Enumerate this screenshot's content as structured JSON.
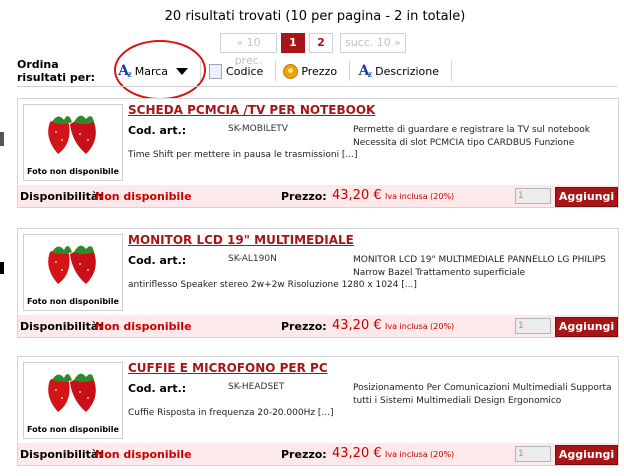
{
  "summary": "20 risultati trovati (10 per pagina - 2 in totale)",
  "pager": {
    "prev": "« 10 prec.",
    "pages": [
      "1",
      "2"
    ],
    "current": "1",
    "next": "succ. 10 »"
  },
  "sort": {
    "label": "Ordina risultati per:",
    "options": [
      {
        "label": "Marca",
        "icon": "az-sort-icon"
      },
      {
        "label": "Codice",
        "icon": "code-list-icon"
      },
      {
        "label": "Prezzo",
        "icon": "coin-icon"
      },
      {
        "label": "Descrizione",
        "icon": "az-sort-icon"
      }
    ]
  },
  "colors": {
    "accent": "#a81516",
    "price": "#c80000",
    "footer_bg": "#fde8ea",
    "annotation_circle": "#d41616"
  },
  "products": [
    {
      "image_caption": "Foto non disponibile",
      "title": "SCHEDA PCMCIA /TV PER NOTEBOOK",
      "code_label": "Cod. art.:",
      "code": "SK-MOBILETV",
      "desc_right": "Permette di guardare e registrare la TV sul notebook Necessita di slot PCMCIA tipo CARDBUS Funzione",
      "desc_bottom": "Time Shift per mettere in pausa le trasmissioni [...]",
      "availability_label": "Disponibilità:",
      "availability": "Non disponibile",
      "price_label": "Prezzo:",
      "price": "43,20 €",
      "price_note": "Iva inclusa (20%)",
      "qty": "1",
      "add_label": "Aggiungi"
    },
    {
      "image_caption": "Foto non disponibile",
      "title": "MONITOR LCD 19\" MULTIMEDIALE",
      "code_label": "Cod. art.:",
      "code": "SK-AL190N",
      "desc_right": "MONITOR LCD 19\" MULTIMEDIALE PANNELLO LG PHILIPS Narrow Bazel Trattamento superficiale",
      "desc_bottom": "antiriflesso Speaker stereo 2w+2w Risoluzione 1280 x 1024 [...]",
      "availability_label": "Disponibilità:",
      "availability": "Non disponibile",
      "price_label": "Prezzo:",
      "price": "43,20 €",
      "price_note": "Iva inclusa (20%)",
      "qty": "1",
      "add_label": "Aggiungi"
    },
    {
      "image_caption": "Foto non disponibile",
      "title": "CUFFIE E MICROFONO PER PC",
      "code_label": "Cod. art.:",
      "code": "SK-HEADSET",
      "desc_right": "Posizionamento Per Comunicazioni Multimediali Supporta tutti i Sistemi Multimediali Design Ergonomico",
      "desc_bottom": "Cuffie Risposta in frequenza 20-20.000Hz [...]",
      "availability_label": "Disponibilità:",
      "availability": "Non disponibile",
      "price_label": "Prezzo:",
      "price": "43,20 €",
      "price_note": "Iva inclusa (20%)",
      "qty": "1",
      "add_label": "Aggiungi"
    }
  ]
}
